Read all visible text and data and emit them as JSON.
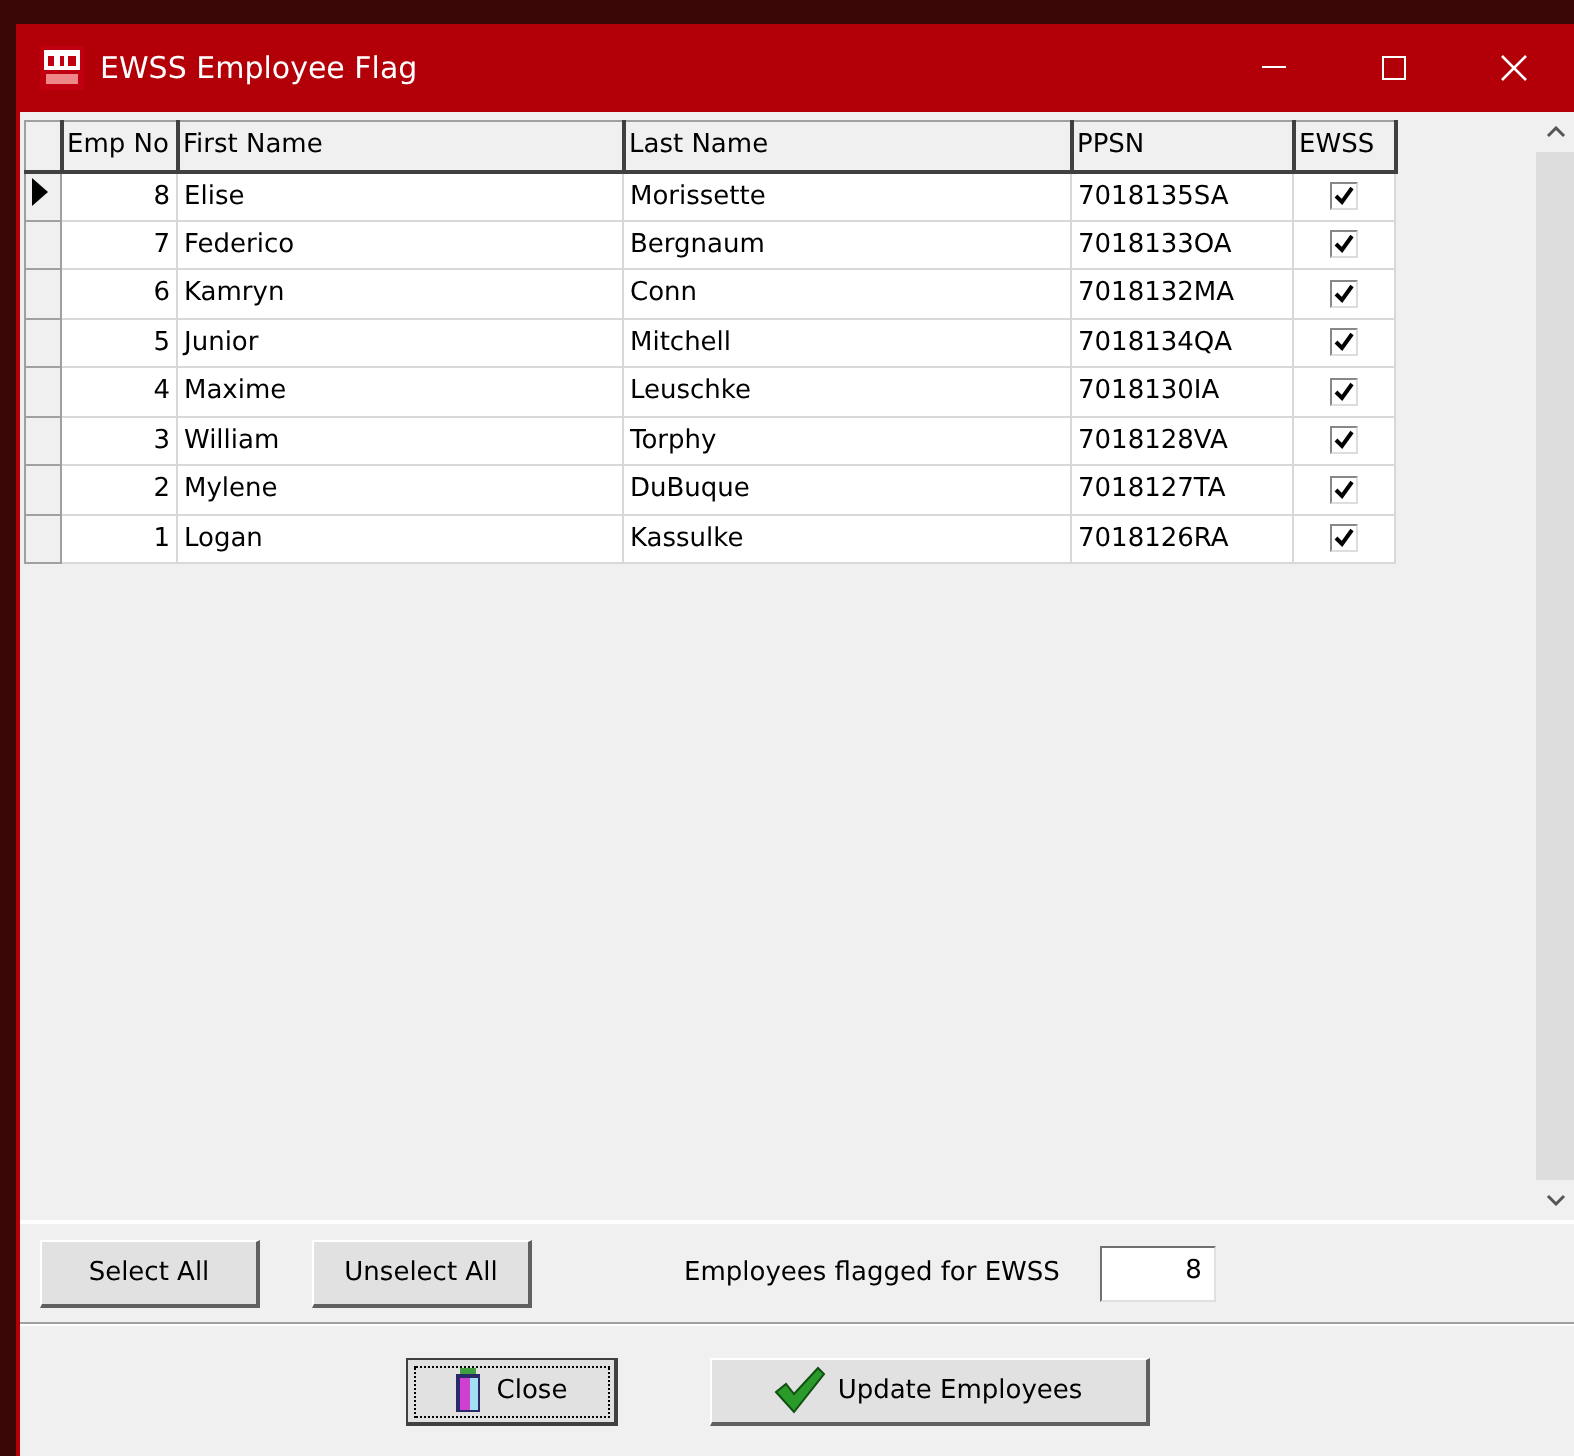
{
  "window": {
    "title": "EWSS Employee Flag"
  },
  "table": {
    "columns": [
      "Emp No",
      "First Name",
      "Last Name",
      "PPSN",
      "EWSS"
    ],
    "rows": [
      {
        "emp_no": "8",
        "first_name": "Elise",
        "last_name": "Morissette",
        "ppsn": "7018135SA",
        "ewss": true,
        "current": true
      },
      {
        "emp_no": "7",
        "first_name": "Federico",
        "last_name": "Bergnaum",
        "ppsn": "7018133OA",
        "ewss": true,
        "current": false
      },
      {
        "emp_no": "6",
        "first_name": "Kamryn",
        "last_name": "Conn",
        "ppsn": "7018132MA",
        "ewss": true,
        "current": false
      },
      {
        "emp_no": "5",
        "first_name": "Junior",
        "last_name": "Mitchell",
        "ppsn": "7018134QA",
        "ewss": true,
        "current": false
      },
      {
        "emp_no": "4",
        "first_name": "Maxime",
        "last_name": "Leuschke",
        "ppsn": "7018130IA",
        "ewss": true,
        "current": false
      },
      {
        "emp_no": "3",
        "first_name": "William",
        "last_name": "Torphy",
        "ppsn": "7018128VA",
        "ewss": true,
        "current": false
      },
      {
        "emp_no": "2",
        "first_name": "Mylene",
        "last_name": "DuBuque",
        "ppsn": "7018127TA",
        "ewss": true,
        "current": false
      },
      {
        "emp_no": "1",
        "first_name": "Logan",
        "last_name": "Kassulke",
        "ppsn": "7018126RA",
        "ewss": true,
        "current": false
      }
    ]
  },
  "select_all": "Select All",
  "unselect_all": "Unselect All",
  "flagged": {
    "label": "Employees flagged for EWSS",
    "value": "8"
  },
  "close": "Close",
  "update": "Update Employees"
}
